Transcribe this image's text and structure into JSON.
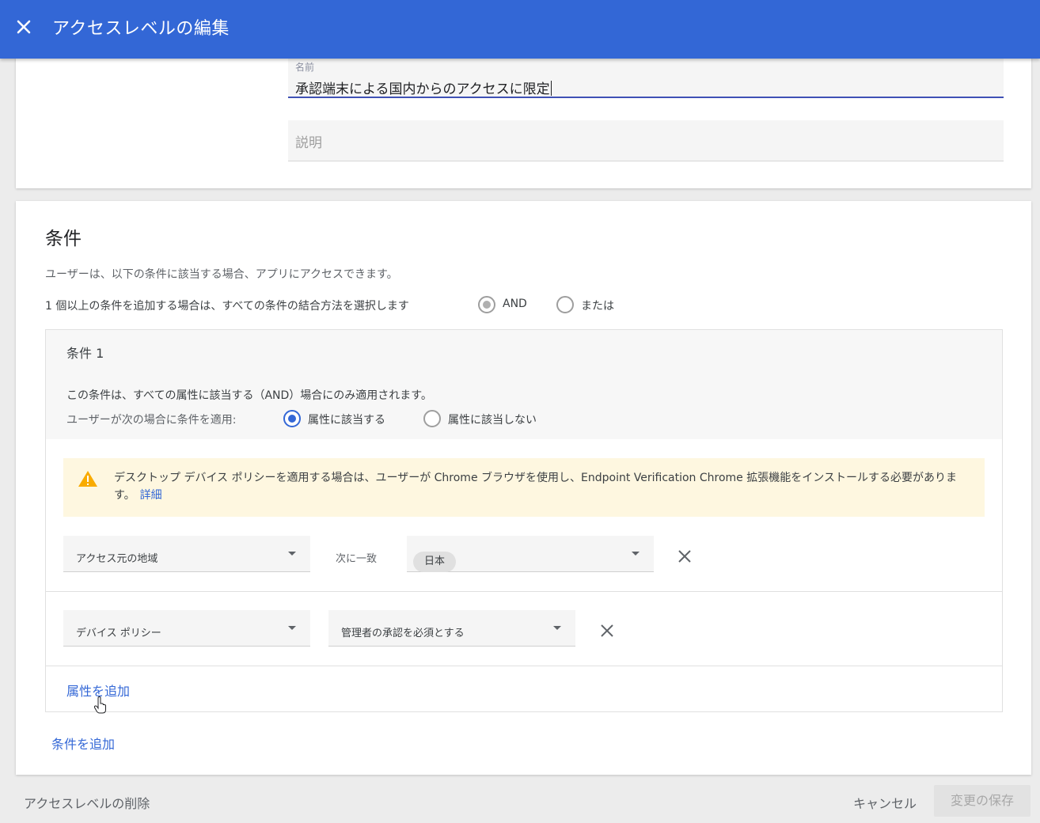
{
  "header": {
    "title": "アクセスレベルの編集",
    "close_icon": "close-icon",
    "background_color": "#3367d6"
  },
  "name_field": {
    "label": "名前",
    "value": "承認端末による国内からのアクセスに限定"
  },
  "description_field": {
    "placeholder": "説明"
  },
  "conditions": {
    "title": "条件",
    "intro": "ユーザーは、以下の条件に該当する場合、アプリにアクセスできます。",
    "combine_prompt": "1 個以上の条件を追加する場合は、すべての条件の結合方法を選択します",
    "combine_options": [
      {
        "label": "AND",
        "selected": true
      },
      {
        "label": "または",
        "selected": false
      }
    ],
    "condition1": {
      "title": "条件 1",
      "description": "この条件は、すべての属性に該当する（AND）場合にのみ適用されます。",
      "apply_prompt": "ユーザーが次の場合に条件を適用:",
      "apply_options": [
        {
          "label": "属性に該当する",
          "selected": true
        },
        {
          "label": "属性に該当しない",
          "selected": false
        }
      ],
      "warning": {
        "icon": "warning-icon",
        "text": "デスクトップ デバイス ポリシーを適用する場合は、ユーザーが Chrome ブラウザを使用し、Endpoint Verification Chrome 拡張機能をインストールする必要があります。",
        "link": "詳細"
      },
      "attributes": [
        {
          "attribute": "アクセス元の地域",
          "operator": "次に一致",
          "value": "日本"
        },
        {
          "attribute": "デバイス ポリシー",
          "value": "管理者の承認を必須とする"
        }
      ],
      "add_attribute": "属性を追加"
    },
    "add_condition": "条件を追加"
  },
  "footer": {
    "delete": "アクセスレベルの削除",
    "cancel": "キャンセル",
    "save": "変更の保存"
  }
}
